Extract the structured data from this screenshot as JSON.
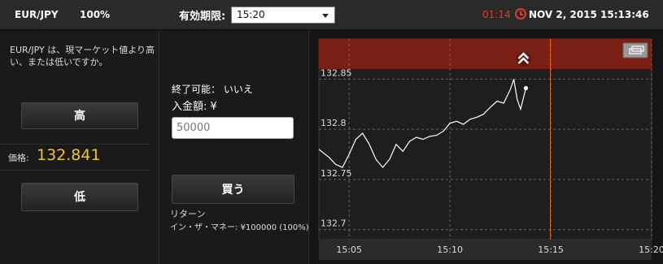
{
  "header": {
    "pair": "EUR/JPY",
    "payout_pct": "100%",
    "expiry_label": "有効期限:",
    "expiry_value": "15:20",
    "countdown": "01:14",
    "datetime": "NOV 2, 2015 15:13:46"
  },
  "left": {
    "question": "EUR/JPY は、現マーケット値より高い、または低いですか。",
    "high_label": "高",
    "low_label": "低",
    "price_label": "価格:",
    "price_value": "132.841"
  },
  "middle": {
    "settle_text": "終了可能： いいえ",
    "amount_label": "入金額: ¥",
    "amount_placeholder": "50000",
    "buy_label": "買う",
    "return_label": "リターン",
    "return_value": "イン・ザ・マネー: ¥100000 (100%)"
  },
  "colors": {
    "accent_price": "#f2c230",
    "countdown": "#e03a2a",
    "expiry_band": "#7a1f14"
  },
  "chart_data": {
    "type": "line",
    "x_ticks": [
      "15:05",
      "15:10",
      "15:15",
      "15:20"
    ],
    "y_ticks": [
      132.7,
      132.75,
      132.8,
      132.85
    ],
    "ylim": [
      132.69,
      132.89
    ],
    "xlim": [
      "15:03:30",
      "15:20:00"
    ],
    "current_marker": "15:13:46",
    "expiry_marker": "15:20",
    "series": [
      {
        "x": [
          "15:03:30",
          "15:04:00",
          "15:04:20",
          "15:04:40",
          "15:05:00",
          "15:05:20",
          "15:05:40",
          "15:06:00",
          "15:06:20",
          "15:06:40",
          "15:07:00",
          "15:07:20",
          "15:07:40",
          "15:08:00",
          "15:08:20",
          "15:08:40",
          "15:09:00",
          "15:09:20",
          "15:09:40",
          "15:10:00",
          "15:10:20",
          "15:10:40",
          "15:11:00",
          "15:11:20",
          "15:11:40",
          "15:12:00",
          "15:12:20",
          "15:12:40",
          "15:13:00",
          "15:13:10",
          "15:13:20",
          "15:13:30",
          "15:13:46"
        ],
        "values": [
          132.78,
          132.772,
          132.765,
          132.762,
          132.775,
          132.79,
          132.796,
          132.785,
          132.77,
          132.762,
          132.77,
          132.785,
          132.778,
          132.788,
          132.792,
          132.79,
          132.793,
          132.794,
          132.798,
          132.806,
          132.808,
          132.805,
          132.81,
          132.812,
          132.815,
          132.822,
          132.828,
          132.826,
          132.84,
          132.85,
          132.83,
          132.82,
          132.841
        ]
      }
    ]
  }
}
